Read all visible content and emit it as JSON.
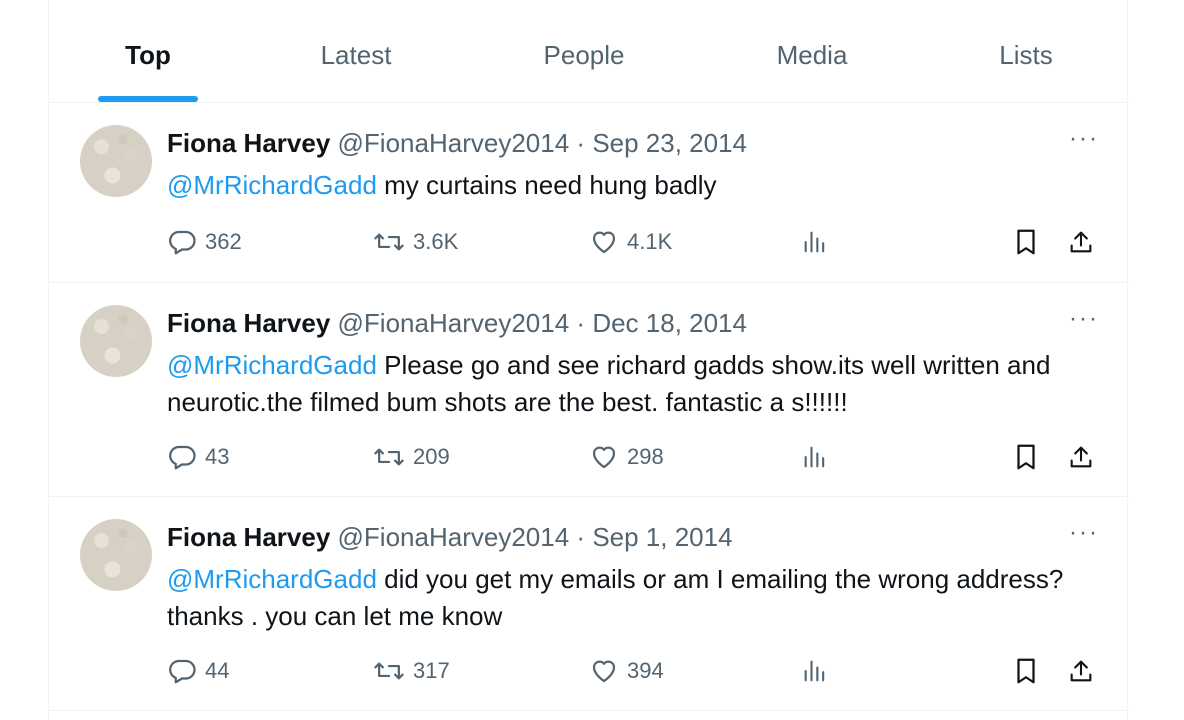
{
  "tabs": [
    {
      "label": "Top",
      "active": true
    },
    {
      "label": "Latest",
      "active": false
    },
    {
      "label": "People",
      "active": false
    },
    {
      "label": "Media",
      "active": false
    },
    {
      "label": "Lists",
      "active": false
    }
  ],
  "tweets": [
    {
      "name": "Fiona Harvey",
      "handle": "@FionaHarvey2014",
      "separator": "·",
      "date": "Sep 23, 2014",
      "mention": "@MrRichardGadd",
      "text": " my curtains need hung badly",
      "replies": "362",
      "retweets": "3.6K",
      "likes": "4.1K",
      "more": "···"
    },
    {
      "name": "Fiona Harvey",
      "handle": "@FionaHarvey2014",
      "separator": "·",
      "date": "Dec 18, 2014",
      "mention": "@MrRichardGadd",
      "text": " Please go and see richard gadds show.its well written and neurotic.the filmed bum shots are the best. fantastic a  s!!!!!!",
      "replies": "43",
      "retweets": "209",
      "likes": "298",
      "more": "···"
    },
    {
      "name": "Fiona Harvey",
      "handle": "@FionaHarvey2014",
      "separator": "·",
      "date": "Sep 1, 2014",
      "mention": "@MrRichardGadd",
      "text": " did you get my emails or am I emailing the wrong address? thanks . you can let me know",
      "replies": "44",
      "retweets": "317",
      "likes": "394",
      "more": "···"
    }
  ],
  "colors": {
    "accent": "#1d9bf0",
    "text": "#0f1419",
    "muted": "#536471",
    "divider": "#eff3f4"
  },
  "icons": [
    "reply-icon",
    "retweet-icon",
    "like-icon",
    "views-icon",
    "bookmark-icon",
    "share-icon",
    "more-icon"
  ]
}
